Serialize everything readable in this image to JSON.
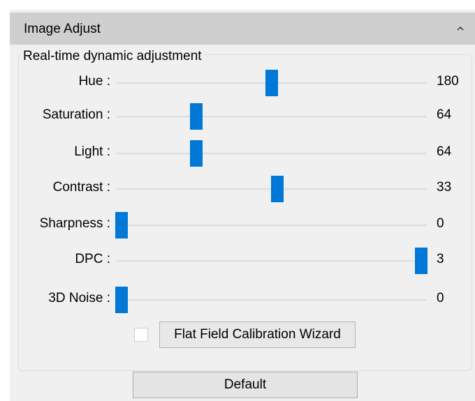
{
  "panel": {
    "title": "Image Adjust",
    "collapse_icon": "chevron-up-icon"
  },
  "group": {
    "legend": "Real-time dynamic adjustment"
  },
  "accent_color": "#0078d7",
  "sliders": [
    {
      "label": "Hue :",
      "value": "180",
      "level": 0.5
    },
    {
      "label": "Saturation :",
      "value": "64",
      "level": 0.25
    },
    {
      "label": "Light :",
      "value": "64",
      "level": 0.25
    },
    {
      "label": "Contrast :",
      "value": "33",
      "level": 0.52
    },
    {
      "label": "Sharpness :",
      "value": "0",
      "level": 0.0
    },
    {
      "label": "DPC :",
      "value": "3",
      "level": 1.0
    },
    {
      "label": "3D Noise :",
      "value": "0",
      "level": 0.0
    }
  ],
  "flat_field": {
    "checked": false,
    "button_label": "Flat Field Calibration Wizard"
  },
  "default_button_label": "Default"
}
